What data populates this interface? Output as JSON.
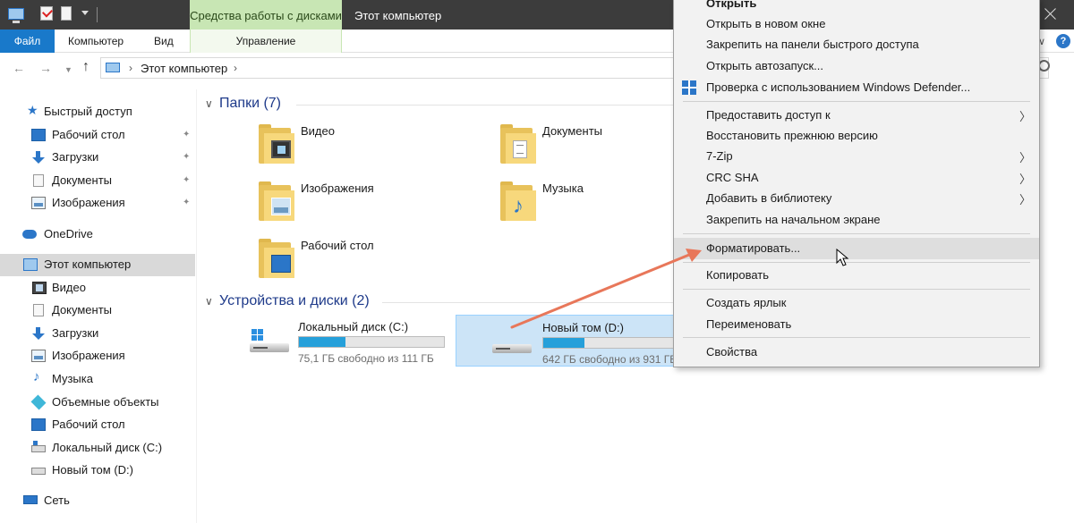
{
  "titlebar": {
    "tools_tab": "Средства работы с дисками",
    "window_title": "Этот компьютер"
  },
  "ribbon": {
    "file": "Файл",
    "computer": "Компьютер",
    "view": "Вид",
    "manage": "Управление"
  },
  "address": {
    "path": "Этот компьютер",
    "separator": "›"
  },
  "sidebar": {
    "items": [
      {
        "label": "Быстрый доступ",
        "icon": "star-icon"
      },
      {
        "label": "Рабочий стол",
        "icon": "desktop-icon",
        "pinned": true
      },
      {
        "label": "Загрузки",
        "icon": "downloads-icon",
        "pinned": true
      },
      {
        "label": "Документы",
        "icon": "documents-icon",
        "pinned": true
      },
      {
        "label": "Изображения",
        "icon": "pictures-icon",
        "pinned": true
      },
      {
        "label": "OneDrive",
        "icon": "onedrive-icon"
      },
      {
        "label": "Этот компьютер",
        "icon": "this-pc-icon",
        "selected": true
      },
      {
        "label": "Видео",
        "icon": "videos-icon"
      },
      {
        "label": "Документы",
        "icon": "documents-icon"
      },
      {
        "label": "Загрузки",
        "icon": "downloads-icon"
      },
      {
        "label": "Изображения",
        "icon": "pictures-icon"
      },
      {
        "label": "Музыка",
        "icon": "music-icon"
      },
      {
        "label": "Объемные объекты",
        "icon": "3d-objects-icon"
      },
      {
        "label": "Рабочий стол",
        "icon": "desktop-icon"
      },
      {
        "label": "Локальный диск (C:)",
        "icon": "drive-c-icon"
      },
      {
        "label": "Новый том (D:)",
        "icon": "drive-d-icon"
      },
      {
        "label": "Сеть",
        "icon": "network-icon"
      }
    ]
  },
  "main": {
    "folders_header": "Папки (7)",
    "folders": [
      {
        "label": "Видео",
        "icon": "videos-folder-icon"
      },
      {
        "label": "Документы",
        "icon": "documents-folder-icon"
      },
      {
        "label": "Изображения",
        "icon": "pictures-folder-icon"
      },
      {
        "label": "Музыка",
        "icon": "music-folder-icon"
      },
      {
        "label": "Рабочий стол",
        "icon": "desktop-folder-icon"
      }
    ],
    "drives_header": "Устройства и диски (2)",
    "drives": [
      {
        "name": "Локальный диск (C:)",
        "free": "75,1 ГБ свободно из 111 ГБ",
        "used_fraction": 0.32
      },
      {
        "name": "Новый том (D:)",
        "free": "642 ГБ свободно из 931 ГБ",
        "used_fraction": 0.31,
        "selected": true
      }
    ]
  },
  "context_menu": {
    "items": [
      {
        "label": "Открыть",
        "bold": true
      },
      {
        "label": "Открыть в новом окне"
      },
      {
        "label": "Закрепить на панели быстрого доступа"
      },
      {
        "label": "Открыть автозапуск..."
      },
      {
        "label": "Проверка с использованием Windows Defender...",
        "icon": "windows-defender-icon"
      },
      {
        "separator": true
      },
      {
        "label": "Предоставить доступ к",
        "submenu": true
      },
      {
        "label": "Восстановить прежнюю версию"
      },
      {
        "label": "7-Zip",
        "submenu": true
      },
      {
        "label": "CRC SHA",
        "submenu": true
      },
      {
        "label": "Добавить в библиотеку",
        "submenu": true
      },
      {
        "label": "Закрепить на начальном экране"
      },
      {
        "separator": true
      },
      {
        "label": "Форматировать...",
        "highlighted": true
      },
      {
        "separator": true
      },
      {
        "label": "Копировать"
      },
      {
        "separator": true
      },
      {
        "label": "Создать ярлык"
      },
      {
        "label": "Переименовать"
      },
      {
        "separator": true
      },
      {
        "label": "Свойства"
      }
    ]
  },
  "colors": {
    "accent": "#1979ca",
    "annotation_arrow": "#e8775a",
    "drive_bar": "#26a0da",
    "tools_tab": "#c8e6b4"
  }
}
